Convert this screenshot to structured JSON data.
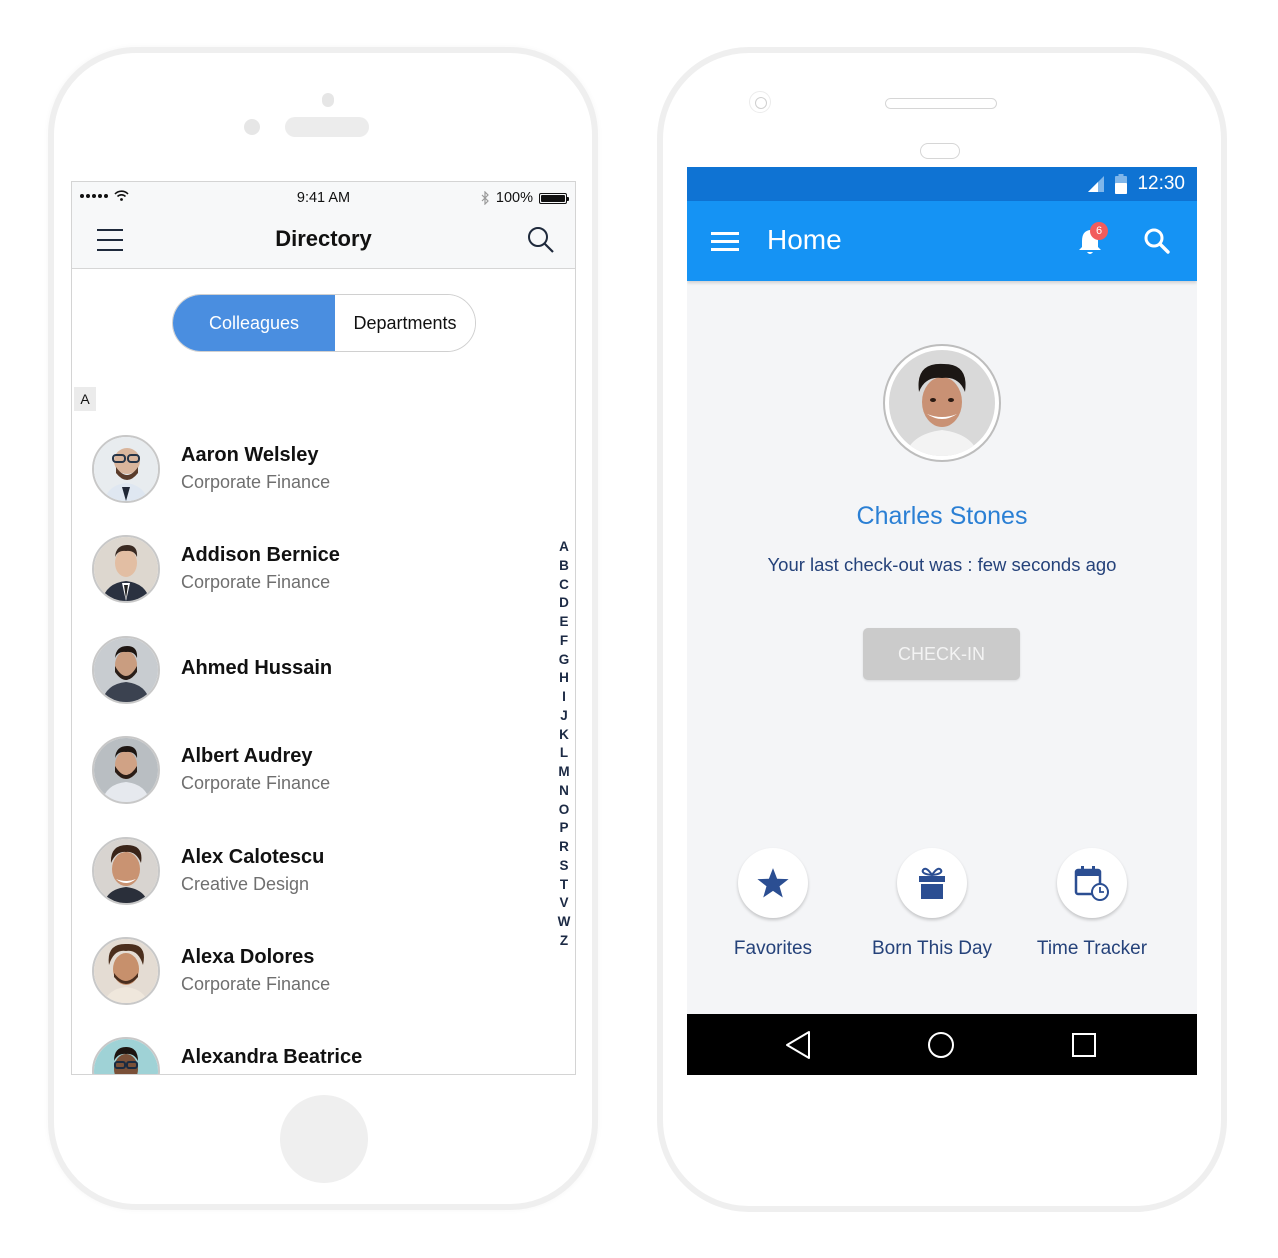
{
  "ios": {
    "status_bar": {
      "signal_dots": 5,
      "time": "9:41 AM",
      "battery": "100%",
      "bluetooth_symbol": "✱"
    },
    "nav": {
      "title": "Directory",
      "menu_icon": "hamburger-icon",
      "search_icon": "search-icon"
    },
    "segments": [
      {
        "label": "Colleagues",
        "active": true
      },
      {
        "label": "Departments",
        "active": false
      }
    ],
    "section_letter": "A",
    "contacts": [
      {
        "name": "Aaron Welsley",
        "department": "Corporate Finance"
      },
      {
        "name": "Addison Bernice",
        "department": "Corporate Finance"
      },
      {
        "name": "Ahmed Hussain",
        "department": ""
      },
      {
        "name": "Albert Audrey",
        "department": "Corporate Finance"
      },
      {
        "name": "Alex Calotescu",
        "department": "Creative Design"
      },
      {
        "name": "Alexa Dolores",
        "department": "Corporate Finance"
      },
      {
        "name": "Alexandra Beatrice",
        "department": ""
      }
    ],
    "alpha_index": [
      "A",
      "B",
      "C",
      "D",
      "E",
      "F",
      "G",
      "H",
      "I",
      "J",
      "K",
      "L",
      "M",
      "N",
      "O",
      "P",
      "R",
      "S",
      "T",
      "V",
      "W",
      "Z"
    ]
  },
  "android": {
    "status_bar": {
      "time": "12:30"
    },
    "appbar": {
      "title": "Home",
      "notification_count": "6"
    },
    "profile": {
      "name": "Charles Stones",
      "last_checkout": "Your last check-out was : few seconds ago"
    },
    "checkin_label": "CHECK-IN",
    "shortcuts": [
      {
        "label": "Favorites",
        "icon": "star-icon"
      },
      {
        "label": "Born This Day",
        "icon": "gift-icon"
      },
      {
        "label": "Time Tracker",
        "icon": "calendar-clock-icon"
      }
    ],
    "colors": {
      "status_bar": "#0f73d3",
      "appbar": "#1593f4",
      "accent_name": "#2a7fd4",
      "text_dark_blue": "#25427a",
      "segment_active": "#4a8ee0",
      "badge": "#f25c5c"
    }
  }
}
